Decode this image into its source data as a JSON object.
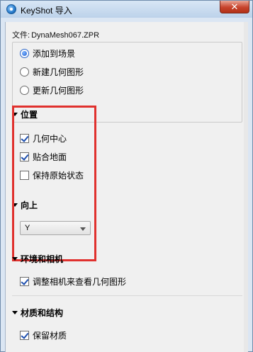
{
  "window": {
    "title": "KeyShot 导入",
    "close_label": "✕"
  },
  "file": {
    "label": "文件:",
    "name": "DynaMesh067.ZPR"
  },
  "import_mode": {
    "options": [
      {
        "label": "添加到场景",
        "selected": true
      },
      {
        "label": "新建几何图形",
        "selected": false
      },
      {
        "label": "更新几何图形",
        "selected": false
      }
    ]
  },
  "position": {
    "title": "位置",
    "options": [
      {
        "label": "几何中心",
        "checked": true
      },
      {
        "label": "贴合地面",
        "checked": true
      },
      {
        "label": "保持原始状态",
        "checked": false
      }
    ]
  },
  "up_axis": {
    "title": "向上",
    "value": "Y"
  },
  "environment_camera": {
    "title": "环境和相机",
    "options": [
      {
        "label": "调整相机来查看几何图形",
        "checked": true
      }
    ]
  },
  "materials": {
    "title": "材质和结构",
    "options": [
      {
        "label": "保留材质",
        "checked": true
      }
    ]
  },
  "colors": {
    "highlight_box": "#e0312e",
    "accent": "#1f5ed1"
  }
}
